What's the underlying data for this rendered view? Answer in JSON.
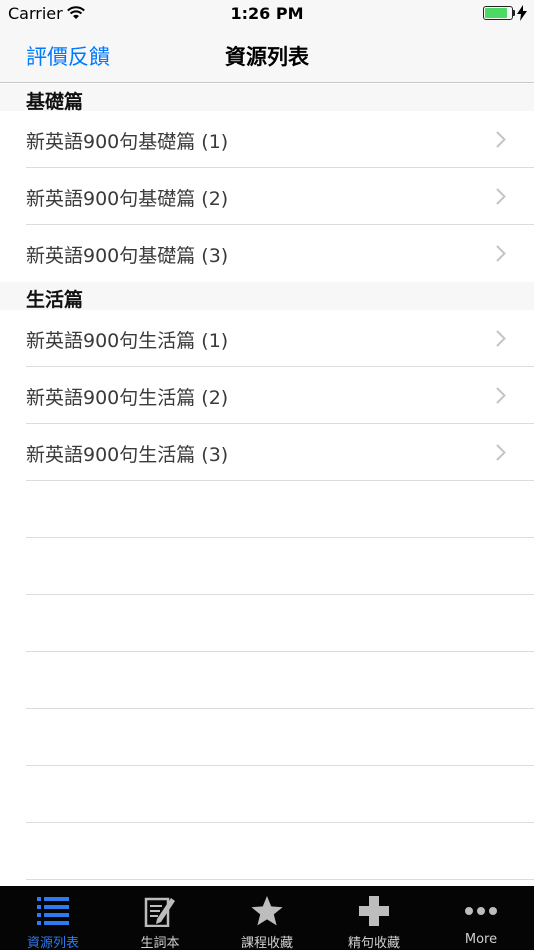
{
  "status_bar": {
    "carrier": "Carrier",
    "time": "1:26 PM",
    "battery_level": 0.85
  },
  "nav": {
    "left_button": "評價反饋",
    "title": "資源列表"
  },
  "sections": [
    {
      "header": "基礎篇",
      "rows": [
        {
          "label": "新英語900句基礎篇 (1)"
        },
        {
          "label": "新英語900句基礎篇 (2)"
        },
        {
          "label": "新英語900句基礎篇 (3)"
        }
      ]
    },
    {
      "header": "生活篇",
      "rows": [
        {
          "label": "新英語900句生活篇 (1)"
        },
        {
          "label": "新英語900句生活篇 (2)"
        },
        {
          "label": "新英語900句生活篇 (3)"
        }
      ]
    }
  ],
  "tabs": [
    {
      "label": "資源列表",
      "icon": "list-icon",
      "active": true
    },
    {
      "label": "生詞本",
      "icon": "notebook-pencil-icon",
      "active": false
    },
    {
      "label": "課程收藏",
      "icon": "star-icon",
      "active": false
    },
    {
      "label": "精句收藏",
      "icon": "plus-icon",
      "active": false
    },
    {
      "label": "More",
      "icon": "more-icon",
      "active": false
    }
  ],
  "colors": {
    "accent": "#007aff",
    "tab_active": "#2d7bf0",
    "tab_bar_bg": "#050505",
    "battery": "#4cd964"
  }
}
